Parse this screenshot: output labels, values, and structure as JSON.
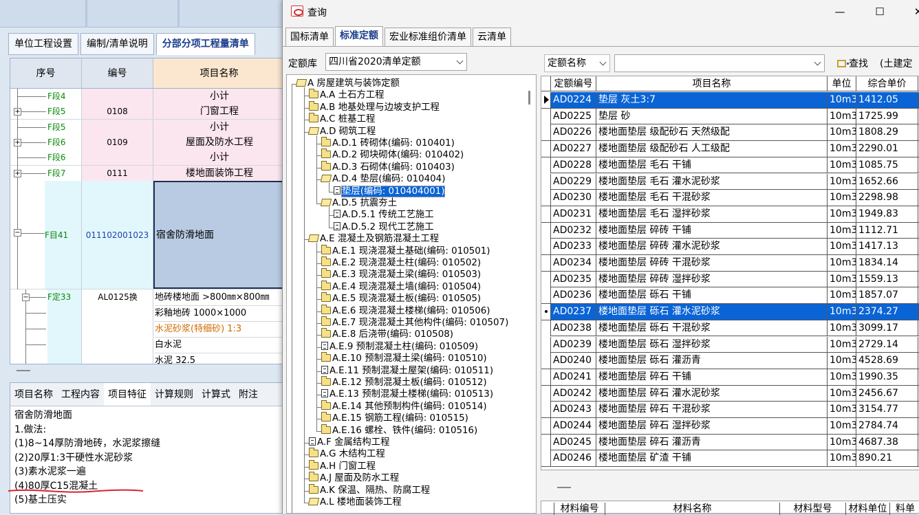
{
  "bg_app": {
    "tabs": [
      {
        "label": "单位工程设置",
        "active": false
      },
      {
        "label": "编制/清单说明",
        "active": false
      },
      {
        "label": "分部分项工程量清单",
        "active": true
      }
    ],
    "grid": {
      "headers": [
        "序号",
        "编号",
        "项目名称"
      ],
      "rows": [
        {
          "seq": "F段4",
          "code": "",
          "name": "小计",
          "expander": false,
          "pink": true
        },
        {
          "seq": "F段5",
          "code": "0108",
          "name": "门窗工程",
          "expander": true,
          "pink": true
        },
        {
          "seq": "F段5",
          "code": "",
          "name": "小计",
          "expander": false,
          "pink": true
        },
        {
          "seq": "F段6",
          "code": "0109",
          "name": "屋面及防水工程",
          "expander": true,
          "pink": true
        },
        {
          "seq": "F段6",
          "code": "",
          "name": "小计",
          "expander": false,
          "pink": true
        },
        {
          "seq": "F段7",
          "code": "0111",
          "name": "楼地面装饰工程",
          "expander": true,
          "pink": true
        }
      ],
      "item": {
        "seq": "F目41",
        "code": "011102001023",
        "name": "宿舍防滑地面"
      },
      "quota": {
        "seq": "F定33",
        "code": "AL0125换",
        "name": "地砖楼地面 >800㎜×800㎜"
      },
      "materials": [
        "彩釉地砖 1000×1000",
        "水泥砂浆(特细砂) 1:3",
        "白水泥",
        "水泥 32.5"
      ]
    },
    "bottom_tabs": [
      {
        "label": "项目名称",
        "active": false
      },
      {
        "label": "工程内容",
        "active": false
      },
      {
        "label": "项目特征",
        "active": true
      },
      {
        "label": "计算规则",
        "active": false
      },
      {
        "label": "计算式",
        "active": false
      },
      {
        "label": "附注",
        "active": false
      }
    ],
    "features": [
      "宿舍防滑地面",
      "1.做法:",
      "(1)8~14厚防滑地砖，水泥浆擦缝",
      "(2)20厚1:3干硬性水泥砂浆",
      "(3)素水泥浆一遍",
      "(4)80厚C15混凝土",
      "(5)基土压实"
    ],
    "annotation_color": "#d9232e"
  },
  "query_window": {
    "title": "查询",
    "controls": {
      "minimize": "—",
      "maximize": "☐",
      "close": "✕"
    },
    "tabs": [
      {
        "label": "国标清单",
        "active": false
      },
      {
        "label": "标准定额",
        "active": true
      },
      {
        "label": "宏业标准组价清单",
        "active": false
      },
      {
        "label": "云清单",
        "active": false
      }
    ],
    "library_label": "定额库",
    "library_value": "四川省2020清单定额",
    "search_field_value": "定额名称",
    "search_input_value": "",
    "search_button": "查找",
    "category_hint": "(土建定",
    "tree": [
      {
        "text": "A 房屋建筑与装饰定额",
        "level": 0,
        "icon": "open"
      },
      {
        "text": "A.A 土石方工程",
        "level": 1,
        "icon": "folder"
      },
      {
        "text": "A.B 地基处理与边坡支护工程",
        "level": 1,
        "icon": "folder"
      },
      {
        "text": "A.C 桩基工程",
        "level": 1,
        "icon": "folder"
      },
      {
        "text": "A.D 砌筑工程",
        "level": 1,
        "icon": "open"
      },
      {
        "text": "A.D.1 砖砌体(编码: 010401)",
        "level": 2,
        "icon": "folder"
      },
      {
        "text": "A.D.2 砌块砌体(编码: 010402)",
        "level": 2,
        "icon": "folder"
      },
      {
        "text": "A.D.3 石砌体(编码: 010403)",
        "level": 2,
        "icon": "folder"
      },
      {
        "text": "A.D.4 垫层(编码: 010404)",
        "level": 2,
        "icon": "open"
      },
      {
        "text": "垫层(编码: 010404001)",
        "level": 3,
        "icon": "doc",
        "selected": true
      },
      {
        "text": "A.D.5 抗震夯土",
        "level": 2,
        "icon": "open"
      },
      {
        "text": "A.D.5.1 传统工艺施工",
        "level": 3,
        "icon": "doc"
      },
      {
        "text": "A.D.5.2 现代工艺施工",
        "level": 3,
        "icon": "doc"
      },
      {
        "text": "A.E 混凝土及钢筋混凝土工程",
        "level": 1,
        "icon": "open"
      },
      {
        "text": "A.E.1 现浇混凝土基础(编码: 010501)",
        "level": 2,
        "icon": "folder"
      },
      {
        "text": "A.E.2 现浇混凝土柱(编码: 010502)",
        "level": 2,
        "icon": "folder"
      },
      {
        "text": "A.E.3 现浇混凝土梁(编码: 010503)",
        "level": 2,
        "icon": "folder"
      },
      {
        "text": "A.E.4 现浇混凝土墙(编码: 010504)",
        "level": 2,
        "icon": "folder"
      },
      {
        "text": "A.E.5 现浇混凝土板(编码: 010505)",
        "level": 2,
        "icon": "folder"
      },
      {
        "text": "A.E.6 现浇混凝土楼梯(编码: 010506)",
        "level": 2,
        "icon": "folder"
      },
      {
        "text": "A.E.7 现浇混凝土其他构件(编码: 010507)",
        "level": 2,
        "icon": "folder"
      },
      {
        "text": "A.E.8 后浇带(编码: 010508)",
        "level": 2,
        "icon": "folder"
      },
      {
        "text": "A.E.9 预制混凝土柱(编码: 010509)",
        "level": 2,
        "icon": "doc"
      },
      {
        "text": "A.E.10 预制混凝土梁(编码: 010510)",
        "level": 2,
        "icon": "folder"
      },
      {
        "text": "A.E.11 预制混凝土屋架(编码: 010511)",
        "level": 2,
        "icon": "doc"
      },
      {
        "text": "A.E.12 预制混凝土板(编码: 010512)",
        "level": 2,
        "icon": "folder"
      },
      {
        "text": "A.E.13 预制混凝土楼梯(编码: 010513)",
        "level": 2,
        "icon": "doc"
      },
      {
        "text": "A.E.14 其他预制构件(编码: 010514)",
        "level": 2,
        "icon": "folder"
      },
      {
        "text": "A.E.15 钢筋工程(编码: 010515)",
        "level": 2,
        "icon": "folder"
      },
      {
        "text": "A.E.16 螺栓、铁件(编码: 010516)",
        "level": 2,
        "icon": "folder"
      },
      {
        "text": "A.F 金属结构工程",
        "level": 1,
        "icon": "doc"
      },
      {
        "text": "A.G 木结构工程",
        "level": 1,
        "icon": "folder"
      },
      {
        "text": "A.H 门窗工程",
        "level": 1,
        "icon": "folder"
      },
      {
        "text": "A.J 屋面及防水工程",
        "level": 1,
        "icon": "folder"
      },
      {
        "text": "A.K 保温、隔热、防腐工程",
        "level": 1,
        "icon": "folder"
      },
      {
        "text": "A.L 楼地面装饰工程",
        "level": 1,
        "icon": "open"
      }
    ],
    "result_headers": [
      "定额编号",
      "项目名称",
      "单位",
      "综合单价"
    ],
    "results": [
      {
        "code": "AD0224",
        "name": "垫层 灰土3:7",
        "unit": "10m3",
        "price": "1412.05",
        "selected": true,
        "marker": "tri"
      },
      {
        "code": "AD0225",
        "name": "垫层 砂",
        "unit": "10m3",
        "price": "1725.99"
      },
      {
        "code": "AD0226",
        "name": "楼地面垫层 级配砂石 天然级配",
        "unit": "10m3",
        "price": "1808.29"
      },
      {
        "code": "AD0227",
        "name": "楼地面垫层 级配砂石 人工级配",
        "unit": "10m3",
        "price": "2290.01"
      },
      {
        "code": "AD0228",
        "name": "楼地面垫层 毛石 干铺",
        "unit": "10m3",
        "price": "1085.75"
      },
      {
        "code": "AD0229",
        "name": "楼地面垫层 毛石 灌水泥砂浆",
        "unit": "10m3",
        "price": "1652.66"
      },
      {
        "code": "AD0230",
        "name": "楼地面垫层 毛石 干混砂浆",
        "unit": "10m3",
        "price": "2298.98"
      },
      {
        "code": "AD0231",
        "name": "楼地面垫层 毛石 湿拌砂浆",
        "unit": "10m3",
        "price": "1949.83"
      },
      {
        "code": "AD0232",
        "name": "楼地面垫层 碎砖 干铺",
        "unit": "10m3",
        "price": "1112.71"
      },
      {
        "code": "AD0233",
        "name": "楼地面垫层 碎砖 灌水泥砂浆",
        "unit": "10m3",
        "price": "1417.13"
      },
      {
        "code": "AD0234",
        "name": "楼地面垫层 碎砖 干混砂浆",
        "unit": "10m3",
        "price": "1834.14"
      },
      {
        "code": "AD0235",
        "name": "楼地面垫层 碎砖 湿拌砂浆",
        "unit": "10m3",
        "price": "1559.13"
      },
      {
        "code": "AD0236",
        "name": "楼地面垫层 砾石 干铺",
        "unit": "10m3",
        "price": "1857.07"
      },
      {
        "code": "AD0237",
        "name": "楼地面垫层 砾石 灌水泥砂浆",
        "unit": "10m3",
        "price": "2374.27",
        "selected": true,
        "marker": "dot"
      },
      {
        "code": "AD0238",
        "name": "楼地面垫层 砾石 干混砂浆",
        "unit": "10m3",
        "price": "3099.17"
      },
      {
        "code": "AD0239",
        "name": "楼地面垫层 砾石 湿拌砂浆",
        "unit": "10m3",
        "price": "2729.14"
      },
      {
        "code": "AD0240",
        "name": "楼地面垫层 砾石 灌沥青",
        "unit": "10m3",
        "price": "4528.69"
      },
      {
        "code": "AD0241",
        "name": "楼地面垫层 碎石 干铺",
        "unit": "10m3",
        "price": "1990.35"
      },
      {
        "code": "AD0242",
        "name": "楼地面垫层 碎石 灌水泥砂浆",
        "unit": "10m3",
        "price": "2456.67"
      },
      {
        "code": "AD0243",
        "name": "楼地面垫层 碎石 干混砂浆",
        "unit": "10m3",
        "price": "3154.77"
      },
      {
        "code": "AD0244",
        "name": "楼地面垫层 碎石 湿拌砂浆",
        "unit": "10m3",
        "price": "2784.74"
      },
      {
        "code": "AD0245",
        "name": "楼地面垫层 碎石 灌沥青",
        "unit": "10m3",
        "price": "4687.38"
      },
      {
        "code": "AD0246",
        "name": "楼地面垫层 矿渣 干铺",
        "unit": "10m3",
        "price": "890.21"
      }
    ],
    "material_headers": [
      "材料编号",
      "材料名称",
      "材料型号",
      "材料单位",
      "料单"
    ]
  }
}
